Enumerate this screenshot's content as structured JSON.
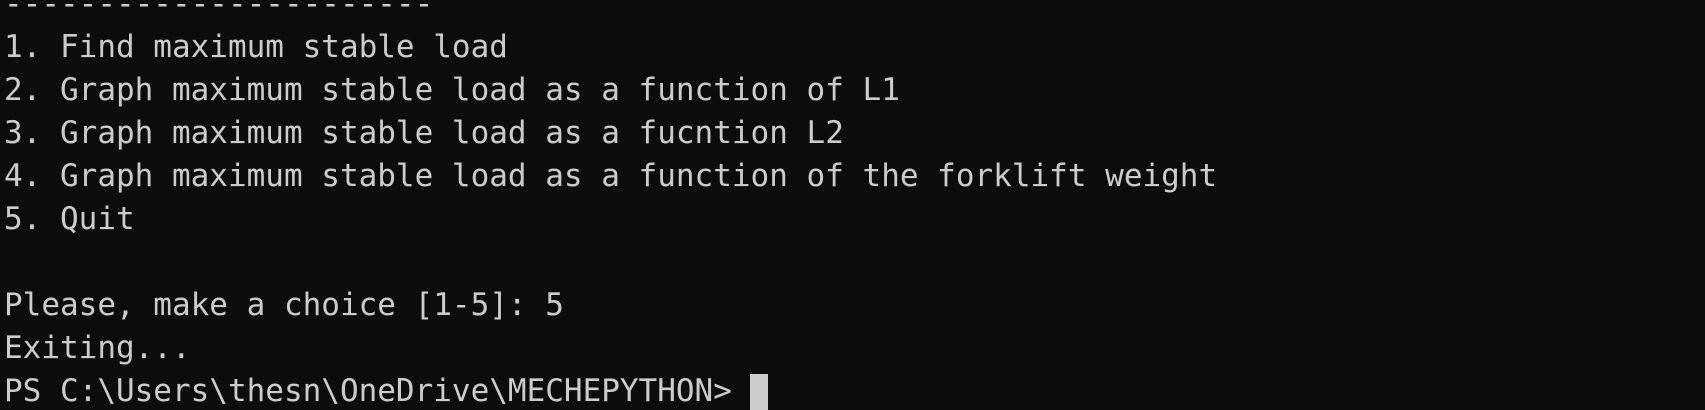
{
  "terminal": {
    "separator": "-----------------------",
    "menu": [
      "1. Find maximum stable load",
      "2. Graph maximum stable load as a function of L1",
      "3. Graph maximum stable load as a fucntion L2",
      "4. Graph maximum stable load as a function of the forklift weight",
      "5. Quit"
    ],
    "blank": "",
    "choice_line": "Please, make a choice [1-5]: 5",
    "exit_line": "Exiting...",
    "prompt": "PS C:\\Users\\thesn\\OneDrive\\MECHEPYTHON>"
  },
  "colors": {
    "background": "#0c0c0c",
    "foreground": "#cccccc",
    "cursor": "#cccccc"
  }
}
